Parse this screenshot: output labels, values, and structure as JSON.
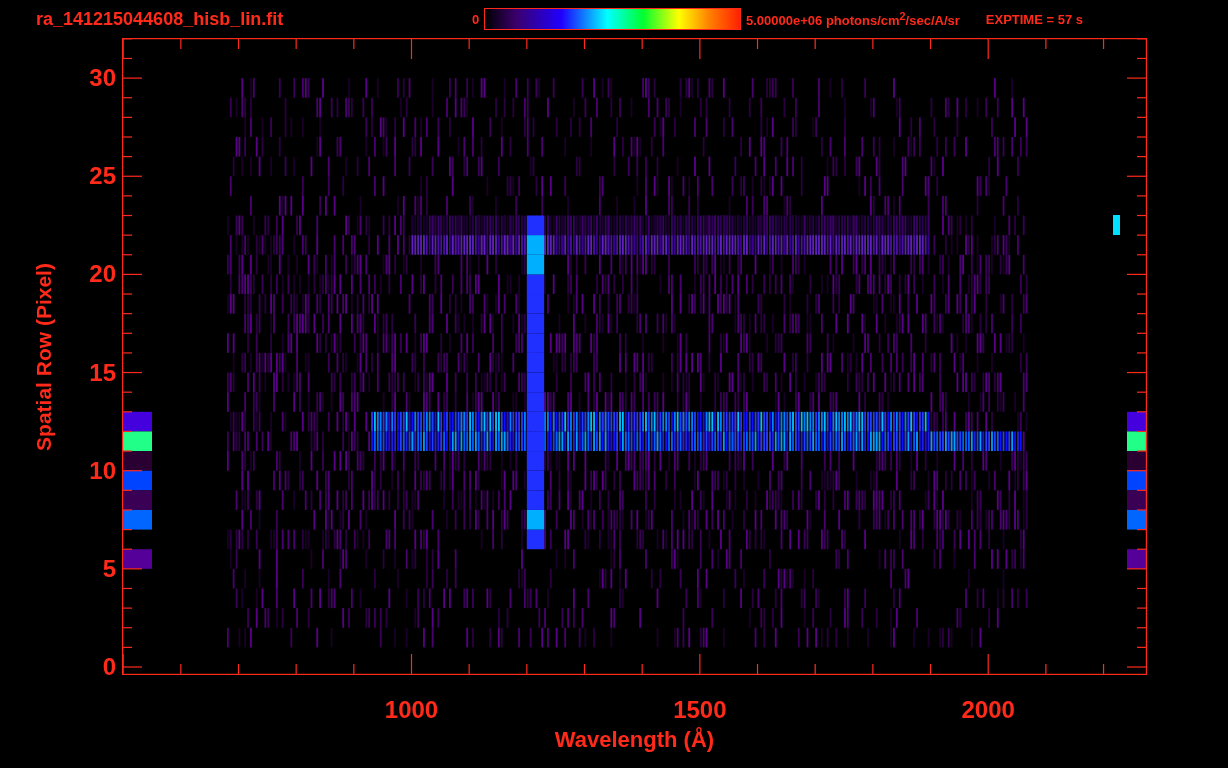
{
  "header": {
    "file_name": "ra_141215044608_hisb_lin.fit",
    "colorbar": {
      "min_label": "0",
      "max_label": "5.00000e+06 photons/cm$^{2}$/sec/A/sr"
    },
    "exposure": "EXPTIME = 57 s"
  },
  "plot": {
    "ylabel": "Spatial Row (Pixel)",
    "yticks": [
      "30",
      "25",
      "20",
      "15",
      "10",
      "5",
      "0"
    ],
    "xticks": [
      "1000",
      "1500",
      "2000"
    ],
    "xlabel": "Wavelength (Å)"
  }
}
